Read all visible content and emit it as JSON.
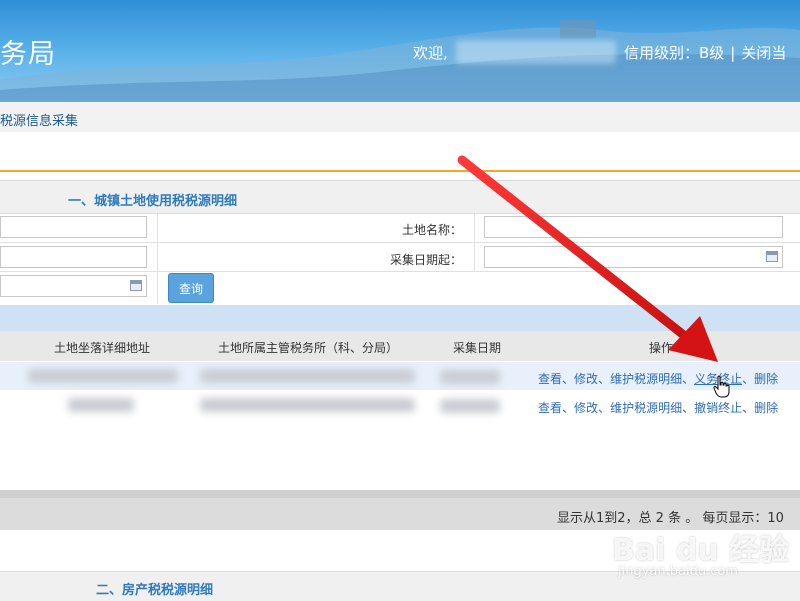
{
  "header": {
    "brand": "务局",
    "welcome": "欢迎,",
    "credit_level": "信用级别：B级",
    "separator": "|",
    "close_label": "关闭当"
  },
  "breadcrumb": "税源信息采集",
  "form": {
    "section_title": "一、城镇土地使用税税源明细",
    "land_name_label": "土地名称：",
    "collect_date_start_label": "采集日期起：",
    "query_button": "查询"
  },
  "table": {
    "headers": [
      "土地坐落详细地址",
      "土地所属主管税务所（科、分局）",
      "采集日期",
      "操作"
    ],
    "rows": [
      {
        "ops": [
          "查看",
          "修改",
          "维护税源明细",
          "义务终止",
          "删除"
        ]
      },
      {
        "ops": [
          "查看",
          "修改",
          "维护税源明细",
          "撤销终止",
          "删除"
        ]
      }
    ],
    "op_separator": "、"
  },
  "pager": {
    "summary": "显示从1到2，总 2 条 。 每页显示：10"
  },
  "section2_title": "二、房产税税源明细",
  "colors": {
    "header_blue": "#2f8fd6",
    "link_blue": "#2f6db3",
    "section_title_blue": "#2f7bbd",
    "accent_orange": "#f5a623",
    "arrow_red": "#e01b1b"
  },
  "icons": [
    "calendar-icon",
    "red-arrow-annotation",
    "hand-cursor-icon"
  ]
}
